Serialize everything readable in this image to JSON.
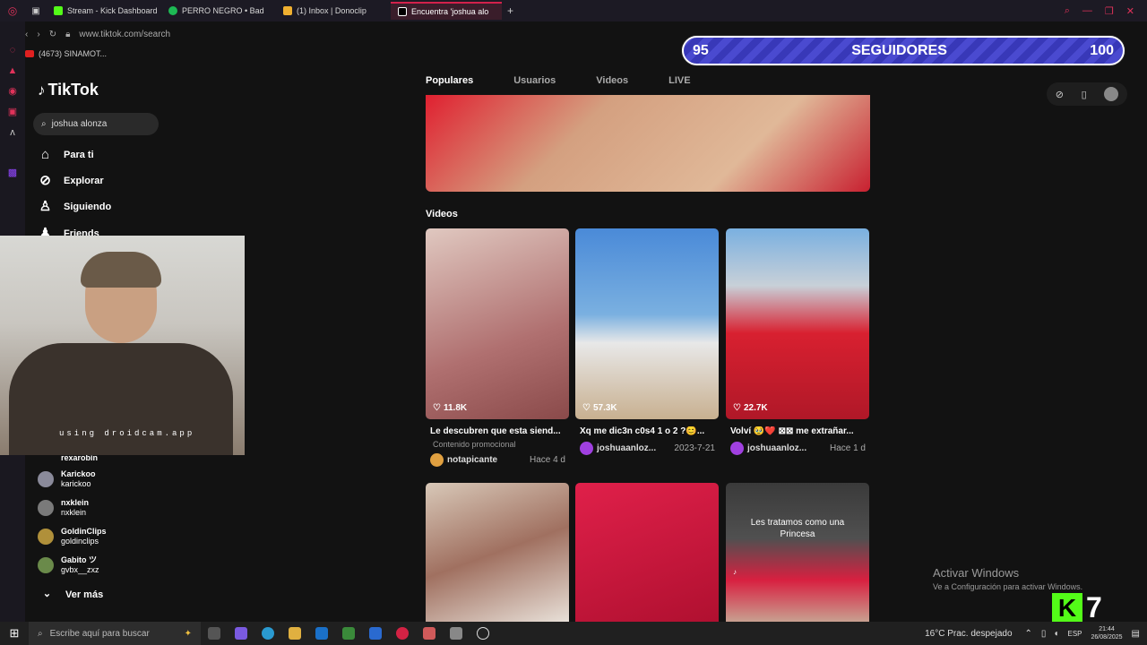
{
  "browser": {
    "tabs": [
      {
        "label": "Stream - Kick Dashboard",
        "color": "#53fc18"
      },
      {
        "label": "PERRO NEGRO • Bad",
        "color": "#1db954"
      },
      {
        "label": "(1) Inbox | Donoclip",
        "color": "#f0b030"
      },
      {
        "label": "Encuentra 'joshua alo",
        "color": "#ffffff"
      }
    ],
    "url": "www.tiktok.com/search",
    "bookmark": "(4673) SINAMOT..."
  },
  "overlay": {
    "goal_current": "95",
    "goal_label": "SEGUIDORES",
    "goal_target": "100"
  },
  "tiktok": {
    "logo": "TikTok",
    "search_value": "joshua alonza",
    "nav": [
      {
        "label": "Para ti",
        "icon": "home-icon"
      },
      {
        "label": "Explorar",
        "icon": "compass-icon"
      },
      {
        "label": "Siguiendo",
        "icon": "following-icon"
      },
      {
        "label": "Friends",
        "icon": "friends-icon"
      }
    ],
    "following": [
      {
        "name": "",
        "user": "rexarobin"
      },
      {
        "name": "Karickoo",
        "user": "karickoo"
      },
      {
        "name": "nxklein",
        "user": "nxklein"
      },
      {
        "name": "GoldinClips",
        "user": "goldinclips"
      },
      {
        "name": "Gabito ツ",
        "user": "gvbx__zxz"
      }
    ],
    "see_more": "Ver más",
    "tabs": [
      "Populares",
      "Usuarios",
      "Videos",
      "LIVE"
    ],
    "videos_label": "Videos",
    "videos": [
      {
        "likes": "11.8K",
        "title": "Le descubren que esta siend...",
        "promo": "Contenido promocional",
        "user": "notapicante",
        "date": "Hace 4 d",
        "bg": "#c8a0a0"
      },
      {
        "likes": "57.3K",
        "title": "Xq me dic3n c0s4 1 o 2 ?😊...",
        "promo": "",
        "user": "joshuaanloz...",
        "date": "2023-7-21",
        "bg": "#5a9ad0"
      },
      {
        "likes": "22.7K",
        "title": "Volví 🥹❤️ ⊠⊠ me extrañar...",
        "promo": "",
        "user": "joshuaanloz...",
        "date": "Hace 1 d",
        "bg": "#d82030"
      }
    ],
    "bottom_overlay_text": "Les tratamos como una Princesa"
  },
  "webcam_watermark": "using droidcam.app",
  "windows": {
    "activate_title": "Activar Windows",
    "activate_sub": "Ve a Configuración para activar Windows.",
    "search_placeholder": "Escribe aquí para buscar",
    "weather": "16°C  Prac. despejado",
    "lang": "ESP",
    "time": "21:44",
    "date": "26/08/2025"
  },
  "kick_count": "7"
}
